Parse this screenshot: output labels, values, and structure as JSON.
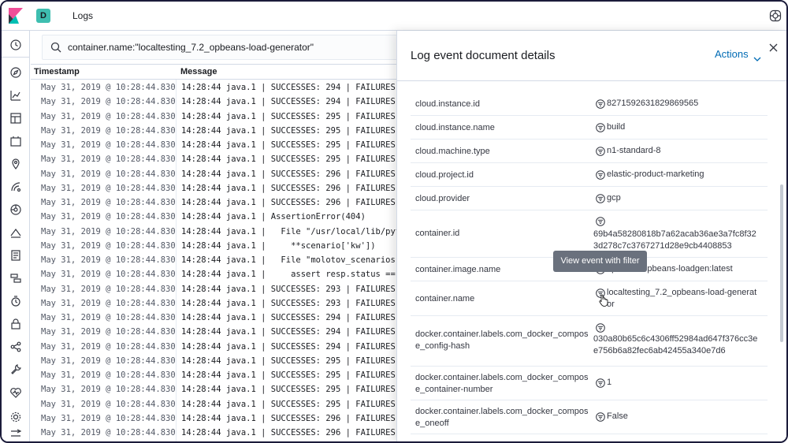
{
  "app": {
    "title": "Logs",
    "space_initial": "D"
  },
  "search": {
    "query": "container.name:\"localtesting_7.2_opbeans-load-generator\""
  },
  "table": {
    "columns": [
      "Timestamp",
      "Message"
    ],
    "rows": [
      {
        "ts": "May 31, 2019 @ 10:28:44.830",
        "msg": "14:28:44 java.1 | SUCCESSES: 294 | FAILURES:"
      },
      {
        "ts": "May 31, 2019 @ 10:28:44.830",
        "msg": "14:28:44 java.1 | SUCCESSES: 294 | FAILURES:"
      },
      {
        "ts": "May 31, 2019 @ 10:28:44.830",
        "msg": "14:28:44 java.1 | SUCCESSES: 295 | FAILURES:"
      },
      {
        "ts": "May 31, 2019 @ 10:28:44.830",
        "msg": "14:28:44 java.1 | SUCCESSES: 295 | FAILURES:"
      },
      {
        "ts": "May 31, 2019 @ 10:28:44.830",
        "msg": "14:28:44 java.1 | SUCCESSES: 295 | FAILURES:"
      },
      {
        "ts": "May 31, 2019 @ 10:28:44.830",
        "msg": "14:28:44 java.1 | SUCCESSES: 295 | FAILURES:"
      },
      {
        "ts": "May 31, 2019 @ 10:28:44.830",
        "msg": "14:28:44 java.1 | SUCCESSES: 296 | FAILURES:"
      },
      {
        "ts": "May 31, 2019 @ 10:28:44.830",
        "msg": "14:28:44 java.1 | SUCCESSES: 296 | FAILURES:"
      },
      {
        "ts": "May 31, 2019 @ 10:28:44.830",
        "msg": "14:28:44 java.1 | SUCCESSES: 296 | FAILURES:"
      },
      {
        "ts": "May 31, 2019 @ 10:28:44.830",
        "msg": "14:28:44 java.1 | AssertionError(404)"
      },
      {
        "ts": "May 31, 2019 @ 10:28:44.830",
        "msg": "14:28:44 java.1 |   File \"/usr/local/lib/pyth"
      },
      {
        "ts": "May 31, 2019 @ 10:28:44.830",
        "msg": "14:28:44 java.1 |     **scenario['kw'])"
      },
      {
        "ts": "May 31, 2019 @ 10:28:44.830",
        "msg": "14:28:44 java.1 |   File \"molotov_scenarios.p"
      },
      {
        "ts": "May 31, 2019 @ 10:28:44.830",
        "msg": "14:28:44 java.1 |     assert resp.status == 2"
      },
      {
        "ts": "May 31, 2019 @ 10:28:44.830",
        "msg": "14:28:44 java.1 | SUCCESSES: 293 | FAILURES:"
      },
      {
        "ts": "May 31, 2019 @ 10:28:44.830",
        "msg": "14:28:44 java.1 | SUCCESSES: 293 | FAILURES:"
      },
      {
        "ts": "May 31, 2019 @ 10:28:44.830",
        "msg": "14:28:44 java.1 | SUCCESSES: 294 | FAILURES:"
      },
      {
        "ts": "May 31, 2019 @ 10:28:44.830",
        "msg": "14:28:44 java.1 | SUCCESSES: 294 | FAILURES:"
      },
      {
        "ts": "May 31, 2019 @ 10:28:44.830",
        "msg": "14:28:44 java.1 | SUCCESSES: 294 | FAILURES:"
      },
      {
        "ts": "May 31, 2019 @ 10:28:44.830",
        "msg": "14:28:44 java.1 | SUCCESSES: 295 | FAILURES:"
      },
      {
        "ts": "May 31, 2019 @ 10:28:44.830",
        "msg": "14:28:44 java.1 | SUCCESSES: 295 | FAILURES:"
      },
      {
        "ts": "May 31, 2019 @ 10:28:44.830",
        "msg": "14:28:44 java.1 | SUCCESSES: 295 | FAILURES:"
      },
      {
        "ts": "May 31, 2019 @ 10:28:44.830",
        "msg": "14:28:44 java.1 | SUCCESSES: 295 | FAILURES:"
      },
      {
        "ts": "May 31, 2019 @ 10:28:44.830",
        "msg": "14:28:44 java.1 | SUCCESSES: 296 | FAILURES:"
      },
      {
        "ts": "May 31, 2019 @ 10:28:44.830",
        "msg": "14:28:44 java.1 | SUCCESSES: 296 | FAILURES:"
      }
    ]
  },
  "flyout": {
    "title": "Log event document details",
    "actions_label": "Actions",
    "fields": [
      {
        "name": "cloud.instance.id",
        "value": "8271592631829869565"
      },
      {
        "name": "cloud.instance.name",
        "value": "build"
      },
      {
        "name": "cloud.machine.type",
        "value": "n1-standard-8"
      },
      {
        "name": "cloud.project.id",
        "value": "elastic-product-marketing"
      },
      {
        "name": "cloud.provider",
        "value": "gcp"
      },
      {
        "name": "container.id",
        "value": "69b4a58280818b7a62acab36ae3a7fc8f323d278c7c3767271d28e9cb4408853"
      },
      {
        "name": "container.image.name",
        "value": "opbeans/opbeans-loadgen:latest"
      },
      {
        "name": "container.name",
        "value": "localtesting_7.2_opbeans-load-generator"
      },
      {
        "name": "docker.container.labels.com_docker_compose_config-hash",
        "value": "030a80b65c6c4306ff52984ad647f376cc3ee756b6a82fec6ab42455a340e7d6"
      },
      {
        "name": "docker.container.labels.com_docker_compose_container-number",
        "value": "1"
      },
      {
        "name": "docker.container.labels.com_docker_compose_oneoff",
        "value": "False"
      },
      {
        "name": "docker.container.labels.com_docker_compo",
        "value": ""
      }
    ]
  },
  "tooltip": {
    "text": "View event with filter"
  },
  "colors": {
    "accent": "#006bb4",
    "space_badge": "#3ebeb0",
    "tooltip_bg": "#6a717d"
  }
}
